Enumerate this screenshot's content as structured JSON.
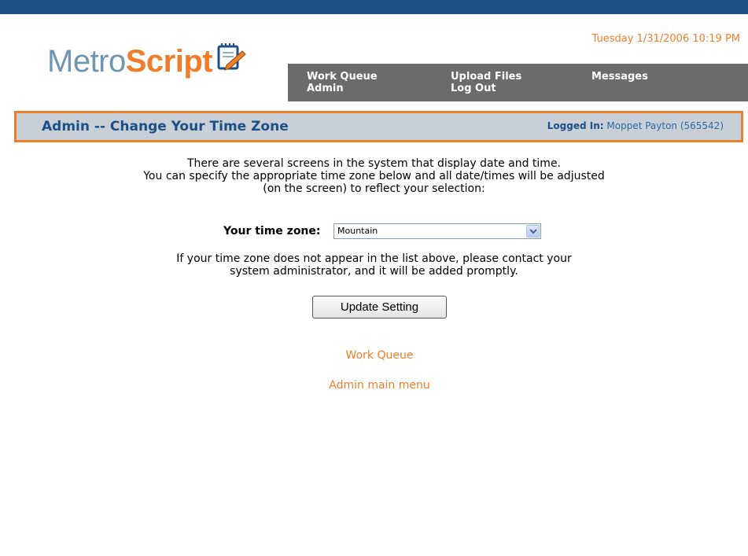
{
  "header": {
    "logo": {
      "part1": "Metro",
      "part2": "Script",
      "icon": "notepad-pencil-icon"
    },
    "datetime": "Tuesday 1/31/2006 10:19 PM",
    "nav": {
      "work_queue": "Work Queue",
      "admin": "Admin",
      "upload_files": "Upload Files",
      "log_out": "Log Out",
      "messages": "Messages"
    }
  },
  "titlebar": {
    "title": "Admin -- Change Your Time Zone",
    "logged_in_label": "Logged In:",
    "logged_in_user": "Moppet Payton (565542)"
  },
  "main": {
    "intro_lines": [
      "There are several screens in the system that display date and time.",
      "You can specify the appropriate time zone below and all date/times will be adjusted",
      "(on the screen) to reflect your selection:"
    ],
    "timezone_label": "Your time zone:",
    "timezone_value": "Mountain",
    "note_lines": [
      "If your time zone does not appear in the list above, please contact your",
      "system administrator, and it will be added promptly."
    ],
    "update_button": "Update Setting",
    "links": {
      "work_queue": "Work Queue",
      "admin_menu": "Admin main menu"
    }
  },
  "colors": {
    "brand_blue": "#1d4f87",
    "brand_orange": "#f07d2a",
    "nav_gray": "#6b6b6b",
    "title_bg": "#c9cfd6"
  }
}
